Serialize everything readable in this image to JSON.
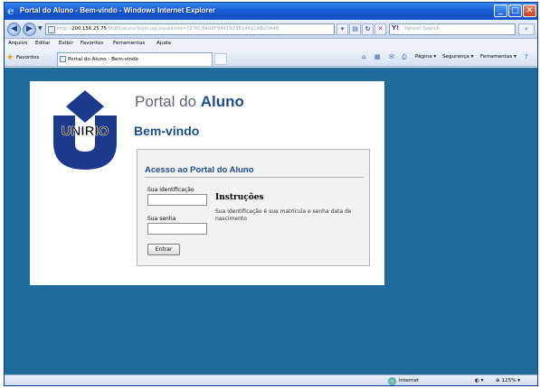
{
  "window": {
    "title": "Portal do Aluno - Bem-vindo - Windows Internet Explorer",
    "buttons": {
      "minimize": "_",
      "maximize": "□",
      "close": "✕"
    }
  },
  "address": {
    "url_prefix": "http://",
    "host": "200.156.25.75",
    "url_rest": ":8080/aluno/login.jsp;jsessionid=7276C8A99F9441923E1441CAB20A48",
    "search_placeholder": "Yahoo! Search"
  },
  "menu": [
    "Arquivo",
    "Editar",
    "Exibir",
    "Favoritos",
    "Ferramentas",
    "Ajuda"
  ],
  "tabs": {
    "favorites_label": "Favoritos",
    "active_tab": "Portal do Aluno - Bem-vindo"
  },
  "commands": {
    "page": "Página",
    "security": "Segurança",
    "tools": "Ferramentas"
  },
  "page": {
    "logo_text": "UNIRIO",
    "title_regular": "Portal do ",
    "title_bold": "Aluno",
    "welcome": "Bem-vindo",
    "login": {
      "title": "Acesso ao Portal do Aluno",
      "id_label": "Sua identificação",
      "id_value": "",
      "password_label": "Sua senha",
      "password_value": "",
      "submit_label": "Entrar"
    },
    "instructions": {
      "title": "Instruções",
      "text": "Sua identificação é sua matrícula e senha data de nascimento"
    }
  },
  "status": {
    "zone": "Internet",
    "zoom": "125%"
  },
  "colors": {
    "page_background": "#1f6b9b",
    "brand_blue": "#1d4c8a"
  }
}
